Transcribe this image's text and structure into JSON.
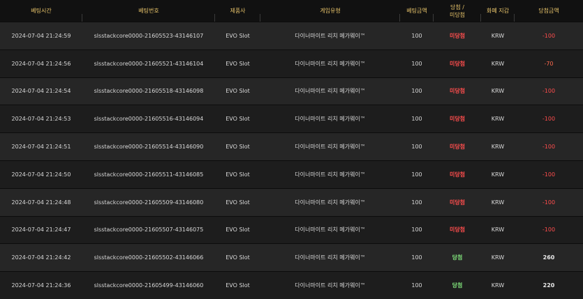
{
  "headers": [
    "베팅시간",
    "베팅번호",
    "제품사",
    "게임유형",
    "베팅금액",
    "당첨 /\n미당첨",
    "화폐 지갑",
    "당첨금액"
  ],
  "rows": [
    {
      "time": "2024-07-04 21:24:59",
      "bet_no": "slsstackcore0000-21605523-43146107",
      "provider": "EVO Slot",
      "game": "다이너마이트 리치 메가웨이™",
      "amount": "100",
      "result": "미당첨",
      "currency": "KRW",
      "win_amount": "-100",
      "win": false
    },
    {
      "time": "2024-07-04 21:24:56",
      "bet_no": "slsstackcore0000-21605521-43146104",
      "provider": "EVO Slot",
      "game": "다이너마이트 리치 메가웨이™",
      "amount": "100",
      "result": "미당첨",
      "currency": "KRW",
      "win_amount": "-70",
      "win": false
    },
    {
      "time": "2024-07-04 21:24:54",
      "bet_no": "slsstackcore0000-21605518-43146098",
      "provider": "EVO Slot",
      "game": "다이너마이트 리치 메가웨이™",
      "amount": "100",
      "result": "미당첨",
      "currency": "KRW",
      "win_amount": "-100",
      "win": false
    },
    {
      "time": "2024-07-04 21:24:53",
      "bet_no": "slsstackcore0000-21605516-43146094",
      "provider": "EVO Slot",
      "game": "다이너마이트 리치 메가웨이™",
      "amount": "100",
      "result": "미당첨",
      "currency": "KRW",
      "win_amount": "-100",
      "win": false
    },
    {
      "time": "2024-07-04 21:24:51",
      "bet_no": "slsstackcore0000-21605514-43146090",
      "provider": "EVO Slot",
      "game": "다이너마이트 리치 메가웨이™",
      "amount": "100",
      "result": "미당첨",
      "currency": "KRW",
      "win_amount": "-100",
      "win": false
    },
    {
      "time": "2024-07-04 21:24:50",
      "bet_no": "slsstackcore0000-21605511-43146085",
      "provider": "EVO Slot",
      "game": "다이너마이트 리치 메가웨이™",
      "amount": "100",
      "result": "미당첨",
      "currency": "KRW",
      "win_amount": "-100",
      "win": false
    },
    {
      "time": "2024-07-04 21:24:48",
      "bet_no": "slsstackcore0000-21605509-43146080",
      "provider": "EVO Slot",
      "game": "다이너마이트 리치 메가웨이™",
      "amount": "100",
      "result": "미당첨",
      "currency": "KRW",
      "win_amount": "-100",
      "win": false
    },
    {
      "time": "2024-07-04 21:24:47",
      "bet_no": "slsstackcore0000-21605507-43146075",
      "provider": "EVO Slot",
      "game": "다이너마이트 리치 메가웨이™",
      "amount": "100",
      "result": "미당첨",
      "currency": "KRW",
      "win_amount": "-100",
      "win": false
    },
    {
      "time": "2024-07-04 21:24:42",
      "bet_no": "slsstackcore0000-21605502-43146066",
      "provider": "EVO Slot",
      "game": "다이너마이트 리치 메가웨이™",
      "amount": "100",
      "result": "당첨",
      "currency": "KRW",
      "win_amount": "260",
      "win": true
    },
    {
      "time": "2024-07-04 21:24:36",
      "bet_no": "slsstackcore0000-21605499-43146060",
      "provider": "EVO Slot",
      "game": "다이너마이트 리치 메가웨이™",
      "amount": "100",
      "result": "당첨",
      "currency": "KRW",
      "win_amount": "220",
      "win": true
    }
  ],
  "colors": {
    "header_text": "#e8c46a",
    "lose": "#ff4d4d",
    "win": "#7fe07a",
    "row_odd": "#262626",
    "row_even": "#1d1d1d"
  }
}
